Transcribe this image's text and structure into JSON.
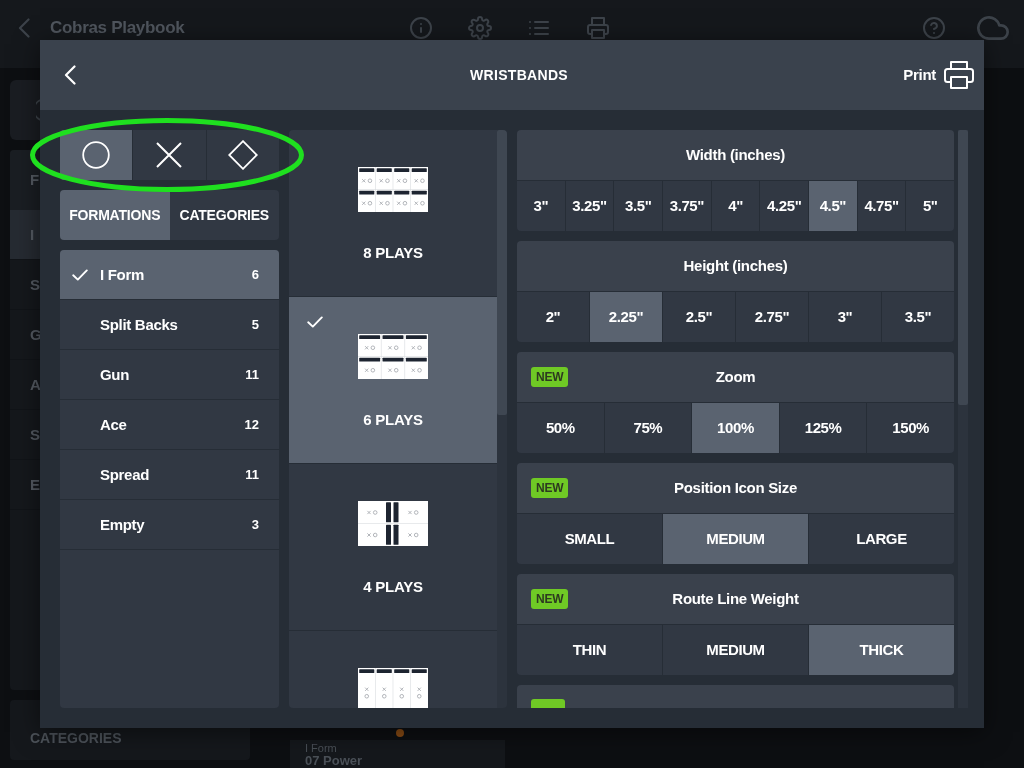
{
  "background_app": {
    "title": "Cobras Playbook",
    "tab_fragment": "F",
    "list_fragments": [
      {
        "label": "I",
        "selected": true
      },
      {
        "label": "S",
        "selected": false
      },
      {
        "label": "G",
        "selected": false
      },
      {
        "label": "A",
        "selected": false
      },
      {
        "label": "S",
        "selected": false
      },
      {
        "label": "E",
        "selected": false
      }
    ],
    "categories_heading": "CATEGORIES",
    "play_card": {
      "formation": "I Form",
      "name": "07 Power"
    }
  },
  "dialog": {
    "title": "WRISTBANDS",
    "print_label": "Print"
  },
  "highlight": {
    "kind": "ellipse"
  },
  "shape_tabs": [
    {
      "kind": "circle",
      "selected": true
    },
    {
      "kind": "cross",
      "selected": false
    },
    {
      "kind": "diamond",
      "selected": false
    }
  ],
  "list_tabs": [
    {
      "label": "FORMATIONS",
      "selected": true
    },
    {
      "label": "CATEGORIES",
      "selected": false
    }
  ],
  "formations": [
    {
      "name": "I Form",
      "count": "6",
      "selected": true
    },
    {
      "name": "Split Backs",
      "count": "5",
      "selected": false
    },
    {
      "name": "Gun",
      "count": "11",
      "selected": false
    },
    {
      "name": "Ace",
      "count": "12",
      "selected": false
    },
    {
      "name": "Spread",
      "count": "11",
      "selected": false
    },
    {
      "name": "Empty",
      "count": "3",
      "selected": false
    }
  ],
  "layouts": [
    {
      "kind": "grid8",
      "label": "8 PLAYS",
      "selected": false
    },
    {
      "kind": "grid6",
      "label": "6 PLAYS",
      "selected": true
    },
    {
      "kind": "grid4",
      "label": "4 PLAYS",
      "selected": false
    },
    {
      "kind": "strip4",
      "selected": false
    }
  ],
  "settings": [
    {
      "kind": "options",
      "title": "Width (inches)",
      "options": [
        {
          "label": "3\"",
          "selected": false
        },
        {
          "label": "3.25\"",
          "selected": false
        },
        {
          "label": "3.5\"",
          "selected": false
        },
        {
          "label": "3.75\"",
          "selected": false
        },
        {
          "label": "4\"",
          "selected": false
        },
        {
          "label": "4.25\"",
          "selected": false
        },
        {
          "label": "4.5\"",
          "selected": true
        },
        {
          "label": "4.75\"",
          "selected": false
        },
        {
          "label": "5\"",
          "selected": false
        }
      ]
    },
    {
      "kind": "options",
      "title": "Height (inches)",
      "options": [
        {
          "label": "2\"",
          "selected": false
        },
        {
          "label": "2.25\"",
          "selected": true
        },
        {
          "label": "2.5\"",
          "selected": false
        },
        {
          "label": "2.75\"",
          "selected": false
        },
        {
          "label": "3\"",
          "selected": false
        },
        {
          "label": "3.5\"",
          "selected": false
        }
      ]
    },
    {
      "kind": "options",
      "title": "Zoom",
      "badge": "NEW",
      "options": [
        {
          "label": "50%",
          "selected": false
        },
        {
          "label": "75%",
          "selected": false
        },
        {
          "label": "100%",
          "selected": true
        },
        {
          "label": "125%",
          "selected": false
        },
        {
          "label": "150%",
          "selected": false
        }
      ]
    },
    {
      "kind": "options",
      "title": "Position Icon Size",
      "badge": "NEW",
      "options": [
        {
          "label": "SMALL",
          "selected": false
        },
        {
          "label": "MEDIUM",
          "selected": true
        },
        {
          "label": "LARGE",
          "selected": false
        }
      ]
    },
    {
      "kind": "options",
      "title": "Route Line Weight",
      "badge": "NEW",
      "options": [
        {
          "label": "THIN",
          "selected": false
        },
        {
          "label": "MEDIUM",
          "selected": false
        },
        {
          "label": "THICK",
          "selected": true
        }
      ]
    },
    {
      "kind": "cut_header",
      "badge_cut": true
    }
  ]
}
